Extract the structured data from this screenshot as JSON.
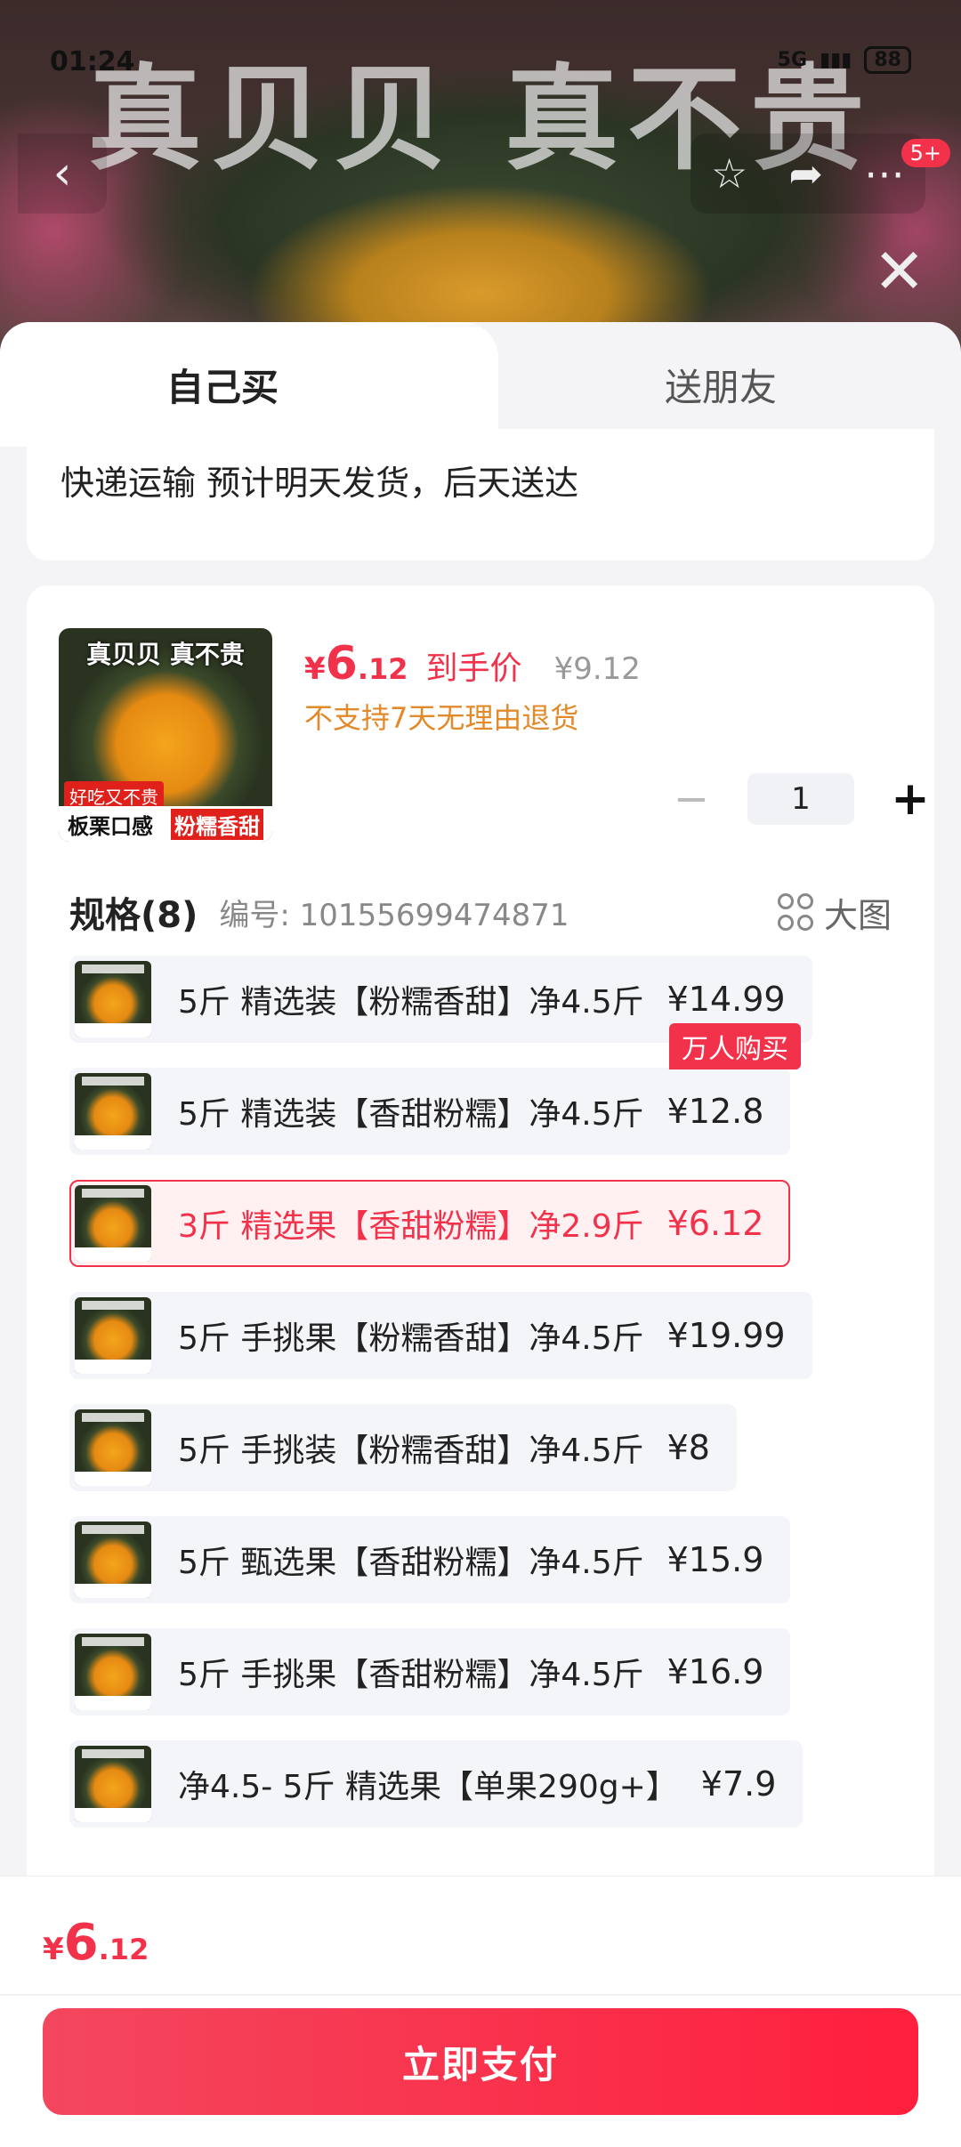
{
  "status_bar": {
    "time": "01:24",
    "network": "5G",
    "battery": "88"
  },
  "hero": {
    "title": "真贝贝 真不贵",
    "cart_badge": "5+"
  },
  "tabs": {
    "self": "自己买",
    "gift": "送朋友"
  },
  "delivery": {
    "text": "快递运输 预计明天发货，后天送达"
  },
  "product": {
    "thumb_title": "真贝贝 真不贵",
    "thumb_tag": "好吃又不贵",
    "thumb_bottom_a": "板栗口感",
    "thumb_bottom_b": "粉糯香甜",
    "price_currency": "¥",
    "price_int": "6",
    "price_dec": ".12",
    "price_label": "到手价",
    "price_old": "¥9.12",
    "return_policy": "不支持7天无理由退货",
    "quantity": "1",
    "minus": "−",
    "plus": "+"
  },
  "spec": {
    "title": "规格(8)",
    "code": "编号: 10155699474871",
    "bigpic": "大图",
    "hot_tag": "万人购买",
    "options": [
      {
        "name": "5斤 精选装【粉糯香甜】净4.5斤",
        "price": "¥14.99"
      },
      {
        "name": "5斤 精选装【香甜粉糯】净4.5斤",
        "price": "¥12.8"
      },
      {
        "name": "3斤 精选果【香甜粉糯】净2.9斤",
        "price": "¥6.12"
      },
      {
        "name": "5斤 手挑果【粉糯香甜】净4.5斤",
        "price": "¥19.99"
      },
      {
        "name": "5斤 手挑装【粉糯香甜】净4.5斤",
        "price": "¥8"
      },
      {
        "name": "5斤 甄选果【香甜粉糯】净4.5斤",
        "price": "¥15.9"
      },
      {
        "name": "5斤 手挑果【香甜粉糯】净4.5斤",
        "price": "¥16.9"
      },
      {
        "name": "净4.5- 5斤 精选果【单果290g+】",
        "price": "¥7.9"
      }
    ]
  },
  "footer": {
    "price_currency": "¥",
    "price_int": "6",
    "price_dec": ".12",
    "pay_label": "立即支付"
  }
}
